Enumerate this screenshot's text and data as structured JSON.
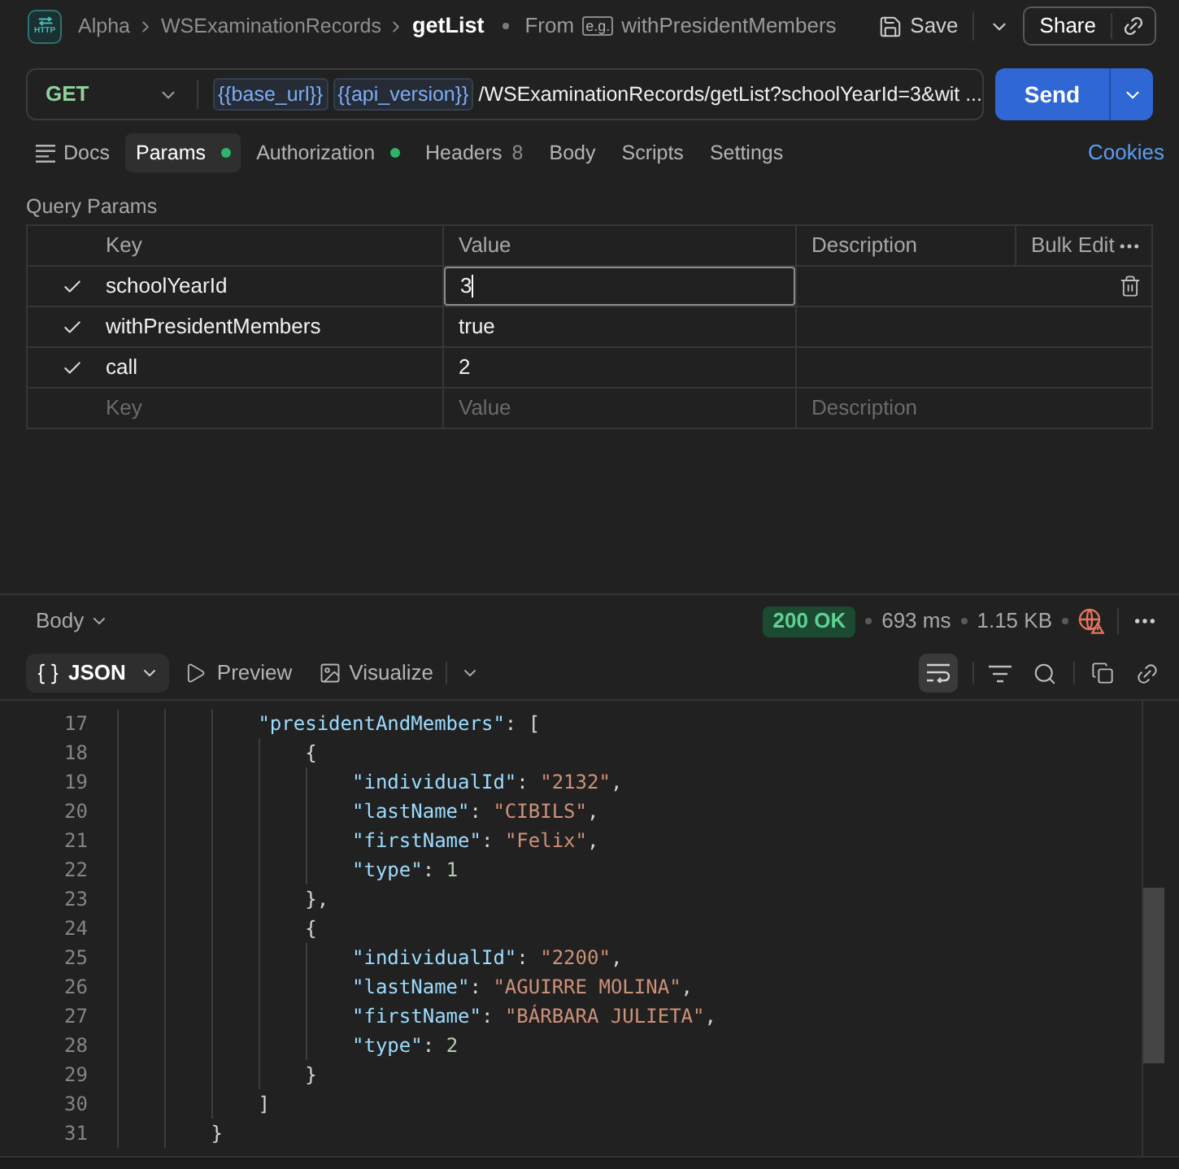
{
  "header": {
    "icon_label": "HTTP",
    "breadcrumb": [
      {
        "label": "Alpha",
        "current": false
      },
      {
        "label": "WSExaminationRecords",
        "current": false
      },
      {
        "label": "getList",
        "current": true
      }
    ],
    "source": {
      "prefix": "From",
      "tag": "e.g.",
      "name": "withPresidentMembers"
    },
    "save": "Save",
    "share": "Share"
  },
  "request": {
    "method": "GET",
    "url": [
      {
        "kind": "variable",
        "text": "{{base_url}}"
      },
      {
        "kind": "variable",
        "text": "{{api_version}}"
      },
      {
        "kind": "path",
        "text": "/WSExaminationRecords/getList?schoolYearId=3&wit ..."
      }
    ],
    "send": "Send"
  },
  "tabs": [
    {
      "label": "Docs",
      "kind": "docs",
      "selected": false,
      "dot": false
    },
    {
      "label": "Params",
      "kind": "section",
      "selected": true,
      "dot": true
    },
    {
      "label": "Authorization",
      "kind": "section",
      "selected": false,
      "dot": true
    },
    {
      "label": "Headers",
      "kind": "section",
      "selected": false,
      "dot": false,
      "count": "8"
    },
    {
      "label": "Body",
      "kind": "section",
      "selected": false,
      "dot": false
    },
    {
      "label": "Scripts",
      "kind": "section",
      "selected": false,
      "dot": false
    },
    {
      "label": "Settings",
      "kind": "section",
      "selected": false,
      "dot": false
    }
  ],
  "cookies": "Cookies",
  "query_params": {
    "title": "Query Params",
    "columns": [
      "Key",
      "Value",
      "Description"
    ],
    "bulk_edit": "Bulk Edit",
    "rows": [
      {
        "checked": true,
        "key": "schoolYearId",
        "value": "3",
        "focused": true
      },
      {
        "checked": true,
        "key": "withPresidentMembers",
        "value": "true",
        "focused": false
      },
      {
        "checked": true,
        "key": "call",
        "value": "2",
        "focused": false
      }
    ],
    "new_row": {
      "key": {
        "placeholder": "Key"
      },
      "value": {
        "placeholder": "Value"
      },
      "description": {
        "placeholder": "Description"
      }
    }
  },
  "response": {
    "view": "Body",
    "status": "200 OK",
    "time": "693 ms",
    "size": "1.15 KB",
    "format": "JSON",
    "preview": "Preview",
    "visualize": "Visualize",
    "word_wrap": true,
    "lines": [
      {
        "number": "17",
        "text": "            \"presidentAndMembers\": ["
      },
      {
        "number": "18",
        "text": "                {"
      },
      {
        "number": "19",
        "text": "                    \"individualId\": \"2132\","
      },
      {
        "number": "20",
        "text": "                    \"lastName\": \"CIBILS\","
      },
      {
        "number": "21",
        "text": "                    \"firstName\": \"Felix\","
      },
      {
        "number": "22",
        "text": "                    \"type\": 1"
      },
      {
        "number": "23",
        "text": "                },"
      },
      {
        "number": "24",
        "text": "                {"
      },
      {
        "number": "25",
        "text": "                    \"individualId\": \"2200\","
      },
      {
        "number": "26",
        "text": "                    \"lastName\": \"AGUIRRE MOLINA\","
      },
      {
        "number": "27",
        "text": "                    \"firstName\": \"BÁRBARA JULIETA\","
      },
      {
        "number": "28",
        "text": "                    \"type\": 2"
      },
      {
        "number": "29",
        "text": "                }"
      },
      {
        "number": "30",
        "text": "            ]"
      },
      {
        "number": "31",
        "text": "        }"
      }
    ]
  }
}
